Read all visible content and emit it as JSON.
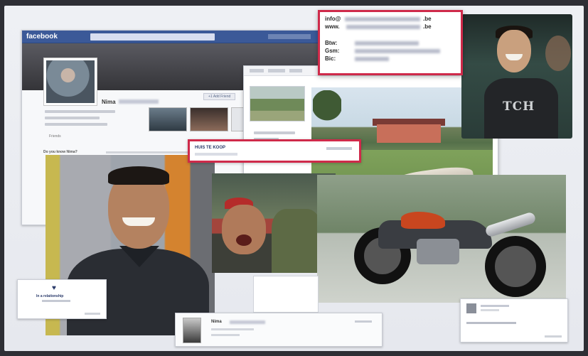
{
  "facebook": {
    "logo": "facebook",
    "profile": {
      "name_label": "Nima",
      "add_friend": "+1 Add Friend"
    },
    "friends_label": "Friends",
    "post_header": "Do you know Nima?"
  },
  "contact": {
    "email_prefix": "info@",
    "email_suffix": ".be",
    "web_prefix": "www.",
    "web_suffix": ".be",
    "fields": [
      "Btw:",
      "Gsm:",
      "Bic:"
    ],
    "highlight_color": "#cf2a4a"
  },
  "market": {
    "listing_label": "HUIS TE KOOP"
  },
  "selfie": {
    "shirt_text": "TCH"
  },
  "relationship": {
    "icon": "heart-icon",
    "label": "In a relationship"
  },
  "bottom_profile": {
    "name_label": "Nima"
  }
}
